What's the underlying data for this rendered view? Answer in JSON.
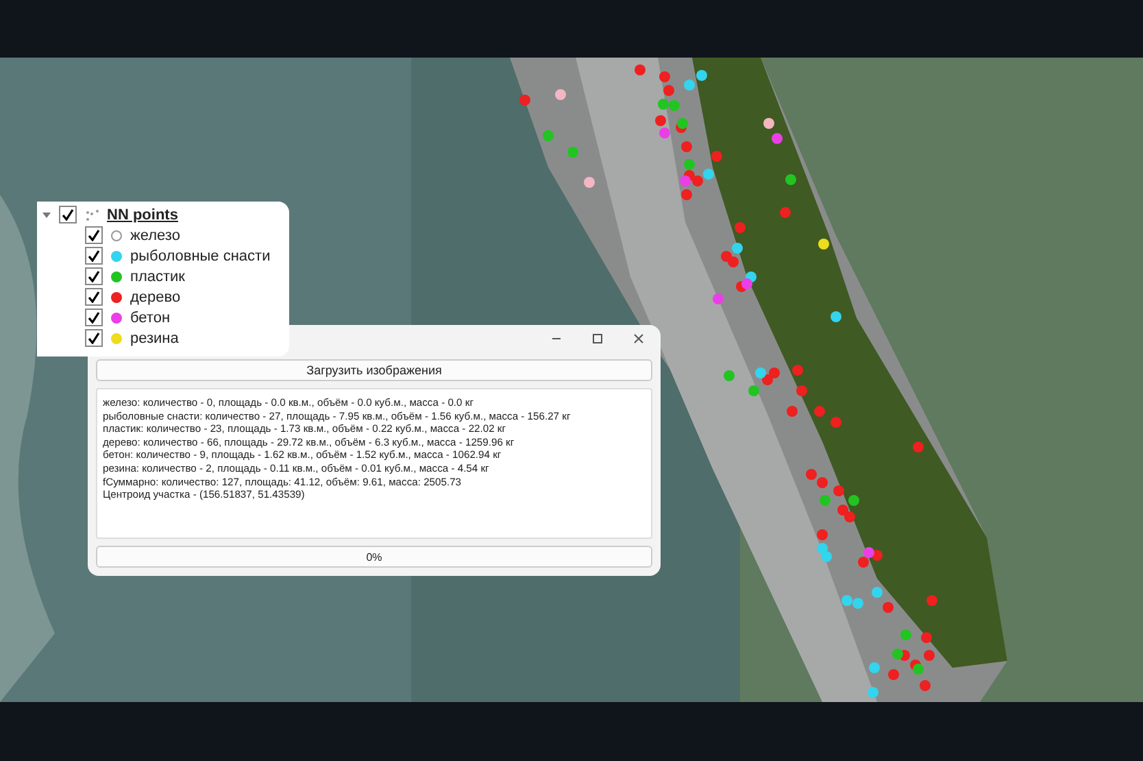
{
  "layers": {
    "title": "NN points",
    "expanded": true,
    "checked": true,
    "items": [
      {
        "label": "железо",
        "checked": true,
        "color": "#ffffff"
      },
      {
        "label": "рыболовные снасти",
        "checked": true,
        "color": "#33d4ee"
      },
      {
        "label": "пластик",
        "checked": true,
        "color": "#22c422"
      },
      {
        "label": "дерево",
        "checked": true,
        "color": "#ee2020"
      },
      {
        "label": "бетон",
        "checked": true,
        "color": "#ea3fe6"
      },
      {
        "label": "резина",
        "checked": true,
        "color": "#eedc1e"
      }
    ]
  },
  "dialog": {
    "load_button": "Загрузить изображения",
    "report_lines": [
      "железо: количество - 0,  площадь - 0.0 кв.м., объём - 0.0 куб.м., масса - 0.0 кг",
      "рыболовные снасти: количество - 27,  площадь - 7.95 кв.м., объём - 1.56 куб.м., масса - 156.27 кг",
      "пластик: количество - 23,  площадь - 1.73 кв.м., объём - 0.22 куб.м., масса - 22.02 кг",
      "дерево: количество - 66,  площадь - 29.72 кв.м., объём - 6.3 куб.м., масса - 1259.96 кг",
      "бетон: количество - 9,  площадь - 1.62 кв.м., объём - 1.52 куб.м., масса - 1062.94 кг",
      "резина: количество - 2,  площадь - 0.11 кв.м., объём - 0.01 куб.м., масса - 4.54 кг",
      "fСуммарно: количество: 127, площадь: 41.12, объём: 9.61, масса: 2505.73",
      "Центроид участка - (156.51837, 51.43539)"
    ],
    "progress": {
      "level": 0,
      "text": "0%"
    }
  }
}
